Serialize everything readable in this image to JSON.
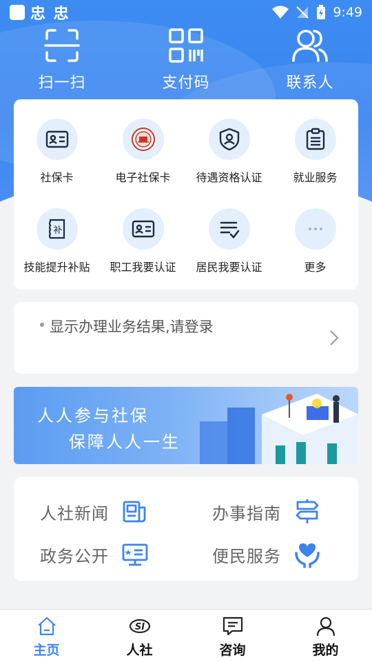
{
  "status_bar": {
    "app_name": "忠 忠",
    "time": "9:49"
  },
  "top_actions": [
    {
      "label": "扫一扫",
      "icon": "scan-icon"
    },
    {
      "label": "支付码",
      "icon": "qr-code-icon"
    },
    {
      "label": "联系人",
      "icon": "contacts-icon"
    }
  ],
  "services": [
    {
      "label": "社保卡",
      "icon": "id-card-icon"
    },
    {
      "label": "电子社保卡",
      "icon": "e-social-card-icon"
    },
    {
      "label": "待遇资格认证",
      "icon": "shield-user-icon"
    },
    {
      "label": "就业服务",
      "icon": "clipboard-icon"
    },
    {
      "label": "技能提升补贴",
      "icon": "subsidy-icon"
    },
    {
      "label": "职工我要认证",
      "icon": "id-card-icon"
    },
    {
      "label": "居民我要认证",
      "icon": "checklist-icon"
    },
    {
      "label": "更多",
      "icon": "more-icon"
    }
  ],
  "login_prompt": "显示办理业务结果,请登录",
  "banner": {
    "line1": "人人参与社保",
    "line2": "保障人人一生"
  },
  "links": [
    {
      "label": "人社新闻",
      "icon": "news-icon"
    },
    {
      "label": "办事指南",
      "icon": "signpost-icon"
    },
    {
      "label": "政务公开",
      "icon": "monitor-icon"
    },
    {
      "label": "便民服务",
      "icon": "heart-hands-icon"
    }
  ],
  "bottom_nav": [
    {
      "label": "主页",
      "icon": "home-icon",
      "active": true
    },
    {
      "label": "人社",
      "icon": "si-logo-icon",
      "active": false
    },
    {
      "label": "咨询",
      "icon": "message-icon",
      "active": false
    },
    {
      "label": "我的",
      "icon": "user-icon",
      "active": false
    }
  ],
  "colors": {
    "primary": "#3b84f0",
    "icon_bg": "#e4effd",
    "page_bg": "#f2f3f5"
  }
}
